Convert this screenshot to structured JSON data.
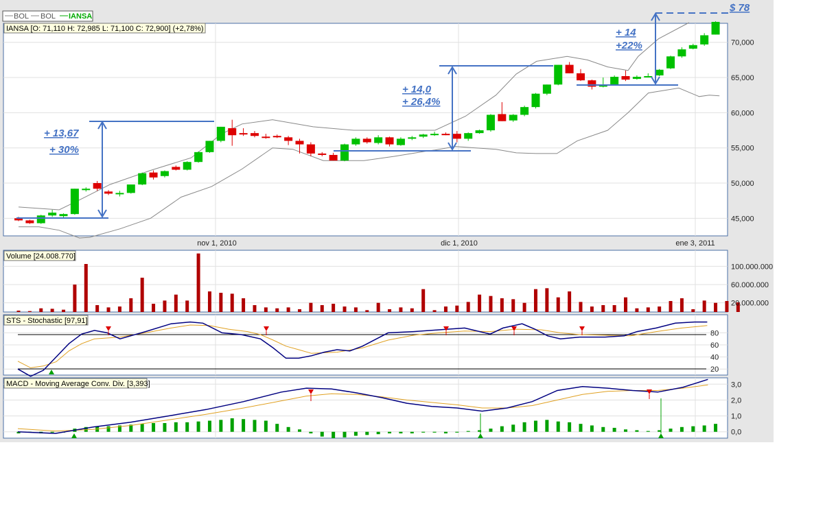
{
  "legend": [
    {
      "label": "BOL",
      "color": "#888888"
    },
    {
      "label": "BOL",
      "color": "#888888"
    },
    {
      "label": "IANSA",
      "color": "#00aa00"
    }
  ],
  "colors": {
    "up": "#00c000",
    "down": "#dd0000",
    "band": "#888888",
    "annot": "#4472c4",
    "stoch_k": "#000080",
    "stoch_d": "#e0a020",
    "volume": "#b00000"
  },
  "price_panel": {
    "info": "IANSA [O: 71,110  H: 72,985  L: 71,100  C: 72,900] (+2,78%)",
    "y_ticks": [
      "45,000",
      "50,000",
      "55,000",
      "60,000",
      "65,000",
      "70,000"
    ],
    "x_ticks": [
      "nov 1, 2010",
      "dic 1, 2010",
      "ene 3, 2011"
    ]
  },
  "volume_panel": {
    "title": "Volume [24.008.770]",
    "y_ticks": [
      "20.000.000",
      "60.000.000",
      "100.000.000"
    ]
  },
  "stoch_panel": {
    "title": "STS - Stochastic [97,91]",
    "y_ticks": [
      "20",
      "40",
      "60",
      "80"
    ]
  },
  "macd_panel": {
    "title": "MACD - Moving Average Conv. Div. [3,393]",
    "y_ticks": [
      "0,0",
      "1,0",
      "2,0",
      "3,0"
    ]
  },
  "annotations": {
    "a1_line1": "+ 13,67",
    "a1_line2": "+ 30%",
    "a2_line1": "+ 14,0",
    "a2_line2": "+ 26,4%",
    "a3_line1": "+ 14",
    "a3_line2": "+22%",
    "target": "$ 78"
  },
  "chart_data": [
    {
      "type": "candlestick",
      "series_name": "IANSA",
      "ylim": [
        42500,
        72700
      ],
      "x_ticks": [
        "nov 1, 2010",
        "dic 1, 2010",
        "ene 3, 2011"
      ],
      "candles": [
        [
          45.0,
          45.2,
          44.6,
          44.7
        ],
        [
          44.7,
          44.8,
          44.2,
          44.3
        ],
        [
          44.3,
          45.5,
          44.2,
          45.4
        ],
        [
          45.4,
          46.2,
          45.2,
          45.8
        ],
        [
          45.3,
          45.7,
          45.0,
          45.6
        ],
        [
          45.6,
          49.2,
          45.5,
          49.2
        ],
        [
          49.0,
          49.4,
          48.8,
          49.2
        ],
        [
          50.0,
          50.3,
          48.9,
          49.2
        ],
        [
          48.8,
          49.0,
          48.3,
          48.5
        ],
        [
          48.5,
          48.9,
          48.1,
          48.6
        ],
        [
          48.6,
          49.8,
          48.5,
          49.8
        ],
        [
          49.8,
          51.5,
          49.7,
          51.4
        ],
        [
          51.5,
          51.8,
          50.5,
          50.8
        ],
        [
          51.0,
          51.8,
          50.8,
          51.7
        ],
        [
          52.3,
          52.5,
          51.8,
          51.9
        ],
        [
          51.9,
          53.1,
          51.8,
          53.0
        ],
        [
          53.0,
          54.5,
          52.9,
          54.4
        ],
        [
          54.4,
          56.0,
          54.3,
          56.0
        ],
        [
          56.0,
          58.0,
          55.8,
          58.0
        ],
        [
          57.8,
          59.0,
          55.3,
          56.8
        ],
        [
          57.1,
          57.8,
          56.7,
          57.0
        ],
        [
          57.1,
          57.4,
          56.5,
          56.7
        ],
        [
          56.6,
          57.0,
          56.3,
          56.5
        ],
        [
          56.7,
          56.9,
          56.4,
          56.6
        ],
        [
          56.5,
          56.7,
          55.4,
          56.0
        ],
        [
          56.0,
          56.3,
          54.2,
          55.5
        ],
        [
          55.5,
          55.8,
          53.8,
          54.2
        ],
        [
          54.2,
          54.4,
          53.8,
          54.0
        ],
        [
          54.0,
          54.3,
          53.2,
          53.2
        ],
        [
          53.2,
          55.6,
          53.1,
          55.5
        ],
        [
          55.5,
          56.5,
          55.3,
          56.3
        ],
        [
          56.3,
          56.5,
          55.6,
          55.8
        ],
        [
          55.7,
          56.8,
          55.5,
          56.5
        ],
        [
          56.5,
          56.6,
          55.2,
          55.5
        ],
        [
          55.4,
          56.5,
          55.3,
          56.3
        ],
        [
          56.3,
          56.7,
          56.1,
          56.5
        ],
        [
          56.6,
          57.0,
          56.4,
          56.9
        ],
        [
          56.9,
          57.3,
          56.7,
          57.0
        ],
        [
          57.0,
          57.2,
          56.8,
          56.9
        ],
        [
          57.0,
          57.4,
          55.8,
          56.3
        ],
        [
          56.3,
          57.2,
          56.0,
          57.1
        ],
        [
          57.1,
          57.6,
          57.0,
          57.5
        ],
        [
          57.5,
          59.8,
          57.3,
          59.7
        ],
        [
          59.8,
          61.5,
          58.8,
          58.8
        ],
        [
          58.9,
          59.8,
          58.7,
          59.7
        ],
        [
          59.7,
          61.0,
          59.5,
          60.8
        ],
        [
          60.8,
          62.8,
          60.6,
          62.7
        ],
        [
          62.7,
          64.0,
          62.5,
          64.0
        ],
        [
          64.0,
          66.8,
          63.9,
          66.8
        ],
        [
          66.8,
          67.2,
          65.6,
          65.6
        ],
        [
          65.6,
          66.2,
          64.5,
          64.6
        ],
        [
          64.6,
          64.7,
          63.3,
          63.7
        ],
        [
          63.7,
          65.0,
          63.6,
          64.0
        ],
        [
          64.0,
          65.3,
          63.9,
          65.1
        ],
        [
          65.2,
          66.0,
          64.5,
          64.7
        ],
        [
          64.8,
          65.3,
          64.7,
          65.1
        ],
        [
          65.2,
          65.6,
          65.0,
          65.2
        ],
        [
          65.3,
          66.2,
          65.2,
          66.1
        ],
        [
          66.3,
          68.1,
          66.2,
          68.0
        ],
        [
          68.0,
          69.3,
          67.8,
          69.0
        ],
        [
          69.1,
          69.8,
          69.0,
          69.6
        ],
        [
          69.7,
          71.3,
          69.5,
          71.0
        ],
        [
          71.1,
          73.0,
          71.1,
          72.9
        ]
      ],
      "bollinger_upper": [
        [
          0,
          46.6
        ],
        [
          4,
          46.2
        ],
        [
          6,
          47.6
        ],
        [
          9,
          49.8
        ],
        [
          13,
          51.8
        ],
        [
          17,
          53.6
        ],
        [
          20,
          57.0
        ],
        [
          22,
          58.4
        ],
        [
          25,
          59.0
        ],
        [
          29,
          58.0
        ],
        [
          33,
          57.5
        ],
        [
          37,
          57.5
        ],
        [
          41,
          57.5
        ],
        [
          44,
          59.5
        ],
        [
          47,
          62.5
        ],
        [
          49,
          65.5
        ],
        [
          51,
          67.3
        ],
        [
          54,
          68.0
        ],
        [
          56,
          67.5
        ],
        [
          58,
          66.5
        ],
        [
          60,
          66.0
        ],
        [
          61,
          68.0
        ],
        [
          63,
          70.5
        ],
        [
          66,
          72.8
        ]
      ],
      "bollinger_lower": [
        [
          0,
          43.8
        ],
        [
          2,
          43.8
        ],
        [
          4,
          43.3
        ],
        [
          6,
          42.2
        ],
        [
          7,
          42.3
        ],
        [
          10,
          43.5
        ],
        [
          13,
          45.0
        ],
        [
          16,
          48.0
        ],
        [
          19,
          49.5
        ],
        [
          22,
          52.0
        ],
        [
          25,
          55.0
        ],
        [
          27,
          54.8
        ],
        [
          30,
          53.2
        ],
        [
          34,
          53.2
        ],
        [
          37,
          53.8
        ],
        [
          40,
          54.5
        ],
        [
          41,
          54.7
        ],
        [
          43,
          55.2
        ],
        [
          45,
          55.0
        ],
        [
          47,
          54.8
        ],
        [
          49,
          54.3
        ],
        [
          51,
          54.2
        ],
        [
          53,
          54.2
        ],
        [
          55,
          56.0
        ],
        [
          58,
          57.5
        ],
        [
          60,
          60.0
        ],
        [
          62,
          62.8
        ],
        [
          65,
          63.5
        ],
        [
          67,
          62.3
        ],
        [
          68,
          62.5
        ],
        [
          69,
          62.4
        ]
      ]
    },
    {
      "type": "bar",
      "series_name": "Volume",
      "ylim": [
        0,
        135000000
      ],
      "values": [
        3,
        2,
        8,
        7,
        5,
        60,
        105,
        15,
        10,
        12,
        30,
        75,
        18,
        25,
        38,
        25,
        128,
        45,
        42,
        40,
        30,
        15,
        10,
        8,
        10,
        6,
        20,
        15,
        18,
        12,
        10,
        4,
        20,
        6,
        10,
        8,
        50,
        4,
        12,
        14,
        22,
        38,
        35,
        30,
        28,
        20,
        50,
        52,
        32,
        45,
        22,
        12,
        15,
        15,
        32,
        8,
        10,
        12,
        24,
        30,
        6,
        25,
        20,
        24,
        21
      ]
    },
    {
      "type": "line",
      "series_name": "STS - Stochastic",
      "ylim": [
        10,
        110
      ],
      "y_ticks": [
        20,
        40,
        60,
        80
      ],
      "k": [
        [
          0,
          20
        ],
        [
          2,
          8
        ],
        [
          4,
          18
        ],
        [
          6,
          40
        ],
        [
          8,
          62
        ],
        [
          10,
          78
        ],
        [
          12,
          84
        ],
        [
          14,
          80
        ],
        [
          16,
          70
        ],
        [
          20,
          82
        ],
        [
          24,
          95
        ],
        [
          27,
          98
        ],
        [
          29,
          96
        ],
        [
          32,
          80
        ],
        [
          35,
          77
        ],
        [
          38,
          70
        ],
        [
          40,
          55
        ],
        [
          42,
          38
        ],
        [
          44,
          38
        ],
        [
          46,
          42
        ],
        [
          48,
          48
        ],
        [
          50,
          52
        ],
        [
          52,
          50
        ],
        [
          54,
          58
        ],
        [
          58,
          80
        ],
        [
          62,
          82
        ],
        [
          66,
          85
        ],
        [
          70,
          88
        ],
        [
          74,
          78
        ],
        [
          76,
          88
        ],
        [
          79,
          95
        ],
        [
          81,
          86
        ],
        [
          83,
          75
        ],
        [
          85,
          70
        ],
        [
          88,
          73
        ],
        [
          92,
          73
        ],
        [
          95,
          75
        ],
        [
          97,
          82
        ],
        [
          100,
          88
        ],
        [
          103,
          96
        ],
        [
          106,
          98
        ],
        [
          108,
          98
        ]
      ],
      "d": [
        [
          0,
          33
        ],
        [
          2,
          22
        ],
        [
          4,
          25
        ],
        [
          6,
          32
        ],
        [
          8,
          50
        ],
        [
          10,
          62
        ],
        [
          12,
          70
        ],
        [
          16,
          73
        ],
        [
          20,
          80
        ],
        [
          24,
          88
        ],
        [
          27,
          93
        ],
        [
          30,
          92
        ],
        [
          33,
          86
        ],
        [
          36,
          82
        ],
        [
          38,
          77
        ],
        [
          40,
          68
        ],
        [
          42,
          58
        ],
        [
          44,
          52
        ],
        [
          46,
          46
        ],
        [
          48,
          47
        ],
        [
          50,
          48
        ],
        [
          54,
          55
        ],
        [
          58,
          68
        ],
        [
          62,
          76
        ],
        [
          66,
          80
        ],
        [
          70,
          83
        ],
        [
          74,
          82
        ],
        [
          78,
          86
        ],
        [
          82,
          85
        ],
        [
          85,
          80
        ],
        [
          88,
          77
        ],
        [
          92,
          76
        ],
        [
          96,
          75
        ],
        [
          100,
          82
        ],
        [
          104,
          88
        ],
        [
          108,
          92
        ]
      ]
    },
    {
      "type": "bar+line",
      "series_name": "MACD",
      "ylim": [
        -0.4,
        3.4
      ],
      "y_ticks": [
        0.0,
        1.0,
        2.0,
        3.0
      ],
      "hist": [
        -0.1,
        -0.05,
        -0.1,
        -0.05,
        -0.05,
        0.2,
        0.3,
        0.35,
        0.35,
        0.4,
        0.45,
        0.5,
        0.55,
        0.55,
        0.6,
        0.6,
        0.65,
        0.7,
        0.75,
        0.85,
        0.8,
        0.75,
        0.7,
        0.5,
        0.3,
        0.15,
        -0.1,
        -0.3,
        -0.4,
        -0.35,
        -0.25,
        -0.2,
        -0.15,
        -0.1,
        -0.1,
        -0.1,
        -0.05,
        -0.05,
        -0.1,
        -0.05,
        0.05,
        0.1,
        0.2,
        0.35,
        0.45,
        0.6,
        0.7,
        0.75,
        0.65,
        0.6,
        0.5,
        0.4,
        0.3,
        0.25,
        0.15,
        0.1,
        0.05,
        0.1,
        0.2,
        0.3,
        0.35,
        0.4,
        0.5
      ],
      "macd_line": [
        [
          0,
          0.0
        ],
        [
          6,
          -0.1
        ],
        [
          12,
          0.3
        ],
        [
          18,
          0.6
        ],
        [
          24,
          1.0
        ],
        [
          30,
          1.4
        ],
        [
          36,
          1.9
        ],
        [
          42,
          2.5
        ],
        [
          46,
          2.75
        ],
        [
          50,
          2.7
        ],
        [
          54,
          2.45
        ],
        [
          58,
          2.15
        ],
        [
          62,
          1.8
        ],
        [
          66,
          1.6
        ],
        [
          70,
          1.5
        ],
        [
          74,
          1.3
        ],
        [
          78,
          1.5
        ],
        [
          82,
          1.9
        ],
        [
          86,
          2.6
        ],
        [
          90,
          2.85
        ],
        [
          94,
          2.75
        ],
        [
          98,
          2.6
        ],
        [
          102,
          2.5
        ],
        [
          106,
          2.8
        ],
        [
          110,
          3.3
        ]
      ],
      "signal_line": [
        [
          0,
          0.2
        ],
        [
          6,
          0.05
        ],
        [
          12,
          0.15
        ],
        [
          18,
          0.4
        ],
        [
          24,
          0.75
        ],
        [
          30,
          1.1
        ],
        [
          36,
          1.5
        ],
        [
          42,
          1.95
        ],
        [
          46,
          2.25
        ],
        [
          50,
          2.4
        ],
        [
          54,
          2.35
        ],
        [
          58,
          2.2
        ],
        [
          62,
          2.0
        ],
        [
          66,
          1.85
        ],
        [
          70,
          1.7
        ],
        [
          74,
          1.5
        ],
        [
          78,
          1.5
        ],
        [
          82,
          1.65
        ],
        [
          86,
          2.0
        ],
        [
          90,
          2.35
        ],
        [
          94,
          2.55
        ],
        [
          98,
          2.6
        ],
        [
          102,
          2.6
        ],
        [
          106,
          2.75
        ],
        [
          110,
          2.95
        ]
      ]
    }
  ]
}
